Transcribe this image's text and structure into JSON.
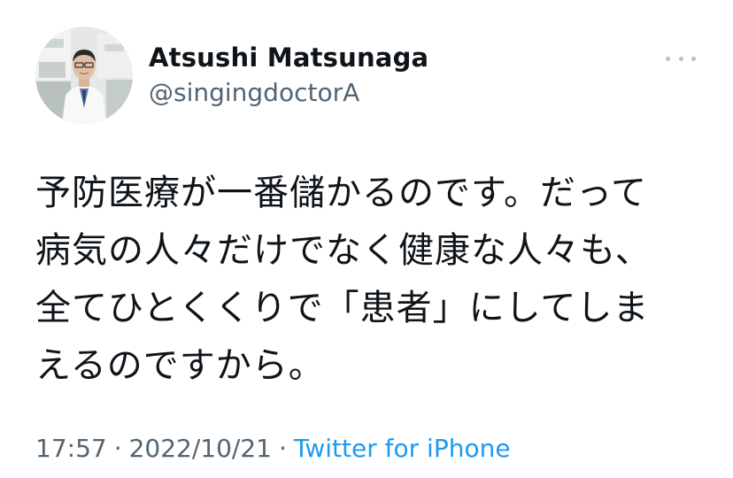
{
  "author": {
    "display_name": "Atsushi Matsunaga",
    "handle": "@singingdoctorA",
    "avatar_icon": "profile-photo"
  },
  "more_icon": "more-horizontal-icon",
  "tweet": {
    "lines": [
      "予防医療が一番儲かるのです。だって",
      "病気の人々だけでなく健康な人々も、",
      "全てひとくくりで「患者」にしてしま",
      "えるのですから。"
    ]
  },
  "meta": {
    "time": "17:57",
    "separator": "·",
    "date": "2022/10/21",
    "source": "Twitter for iPhone"
  },
  "colors": {
    "text": "#0f1419",
    "secondary": "#536471",
    "link": "#1d9bf0"
  }
}
